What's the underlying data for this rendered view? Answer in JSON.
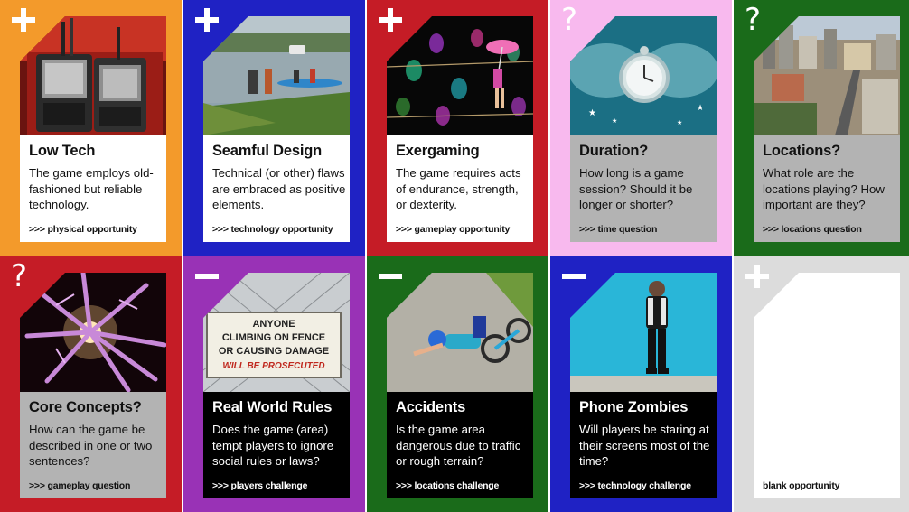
{
  "cards": [
    {
      "title": "Low Tech",
      "desc": "The game employs old-fashioned but reliable technology.",
      "footer": ">>> physical opportunity",
      "marker": "+",
      "frame": "#f39a2b",
      "body": "#ffffff"
    },
    {
      "title": "Seamful Design",
      "desc": "Technical (or other) flaws are embraced as positive elements.",
      "footer": ">>> technology opportunity",
      "marker": "+",
      "frame": "#1f22c4",
      "body": "#ffffff"
    },
    {
      "title": "Exergaming",
      "desc": "The game requires acts of endurance, strength, or dexterity.",
      "footer": ">>> gameplay opportunity",
      "marker": "+",
      "frame": "#c51c26",
      "body": "#ffffff"
    },
    {
      "title": "Duration?",
      "desc": "How long is a game session? Should it be longer or shorter?",
      "footer": ">>> time question",
      "marker": "?",
      "frame": "#f8b9ee",
      "body": "#b3b3b3"
    },
    {
      "title": "Locations?",
      "desc": "What role are the locations playing? How important are they?",
      "footer": ">>> locations question",
      "marker": "?",
      "frame": "#1a6b1a",
      "body": "#b3b3b3"
    },
    {
      "title": "Core Concepts?",
      "desc": "How can the game be described in one or two sentences?",
      "footer": ">>> gameplay question",
      "marker": "?",
      "frame": "#c51c26",
      "body": "#b3b3b3"
    },
    {
      "title": "Real World Rules",
      "desc": "Does the game (area) tempt players to ignore social rules or laws?",
      "footer": ">>> players challenge",
      "marker": "−",
      "frame": "#9932b6",
      "body": "#000000"
    },
    {
      "title": "Accidents",
      "desc": "Is the game area dangerous due to traffic or rough terrain?",
      "footer": ">>> locations challenge",
      "marker": "−",
      "frame": "#1a6b1a",
      "body": "#000000"
    },
    {
      "title": "Phone Zombies",
      "desc": "Will players be staring at their screens most of the time?",
      "footer": ">>> technology challenge",
      "marker": "−",
      "frame": "#1f22c4",
      "body": "#000000"
    },
    {
      "title": "",
      "desc": "",
      "footer": "blank opportunity",
      "marker": "+",
      "frame": "#dcdcdc",
      "body": "#ffffff"
    }
  ],
  "sign": {
    "line1": "ANYONE",
    "line2": "CLIMBING ON FENCE",
    "line3": "OR CAUSING DAMAGE",
    "line4": "WILL BE PROSECUTED"
  }
}
